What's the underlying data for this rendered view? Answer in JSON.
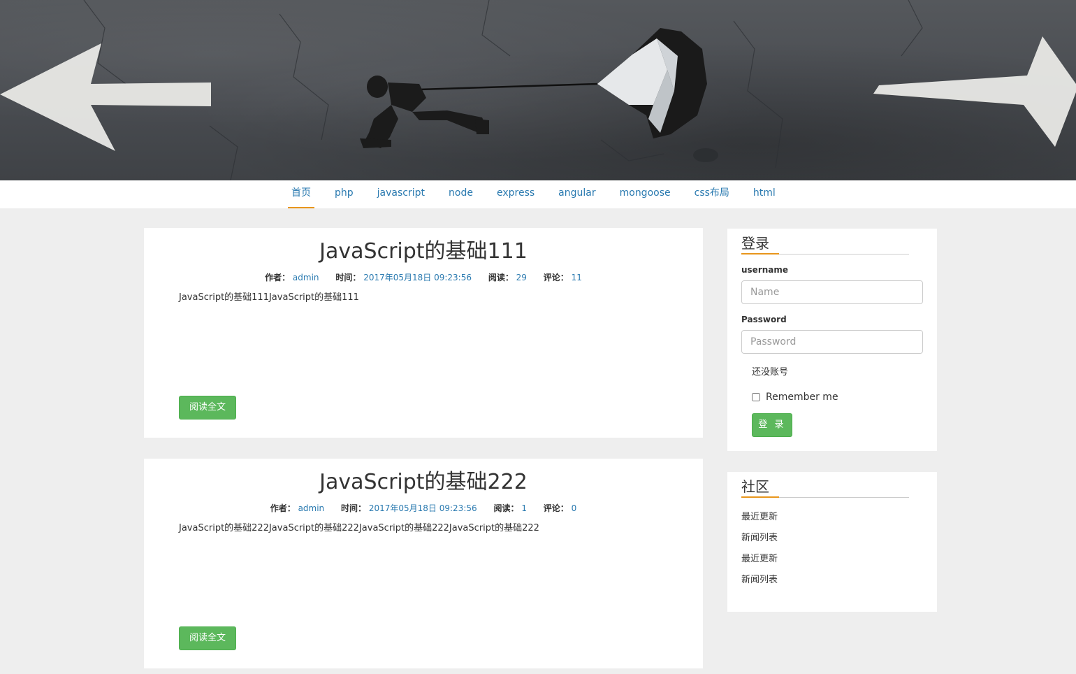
{
  "banner": {
    "alt": "banner photo: runner pulling a parachute between two road arrows"
  },
  "nav": {
    "items": [
      {
        "label": "首页",
        "active": true
      },
      {
        "label": "php"
      },
      {
        "label": "javascript"
      },
      {
        "label": "node"
      },
      {
        "label": "express"
      },
      {
        "label": "angular"
      },
      {
        "label": "mongoose"
      },
      {
        "label": "css布局"
      },
      {
        "label": "html"
      }
    ],
    "accent_color": "#e8961c",
    "link_color": "#2a7ab0"
  },
  "articles": [
    {
      "title": "JavaScript的基础111",
      "author_label": "作者：",
      "author": "admin",
      "time_label": "时间：",
      "time": "2017年05月18日 09:23:56",
      "reads_label": "阅读：",
      "reads": "29",
      "comments_label": "评论：",
      "comments": "11",
      "summary": "JavaScript的基础111JavaScript的基础111",
      "read_more": "阅读全文"
    },
    {
      "title": "JavaScript的基础222",
      "author_label": "作者：",
      "author": "admin",
      "time_label": "时间：",
      "time": "2017年05月18日 09:23:56",
      "reads_label": "阅读：",
      "reads": "1",
      "comments_label": "评论：",
      "comments": "0",
      "summary": "JavaScript的基础222JavaScript的基础222JavaScript的基础222JavaScript的基础222",
      "read_more": "阅读全文"
    }
  ],
  "login": {
    "title": "登录",
    "username_label": "username",
    "username_placeholder": "Name",
    "password_label": "Password",
    "password_placeholder": "Password",
    "no_account": "还没账号",
    "remember_label": "Remember me",
    "submit": "登 录"
  },
  "community": {
    "title": "社区",
    "items": [
      "最近更新",
      "新闻列表",
      "最近更新",
      "新闻列表"
    ]
  },
  "colors": {
    "button_green": "#5cb85c",
    "page_bg": "#eeeeee"
  }
}
